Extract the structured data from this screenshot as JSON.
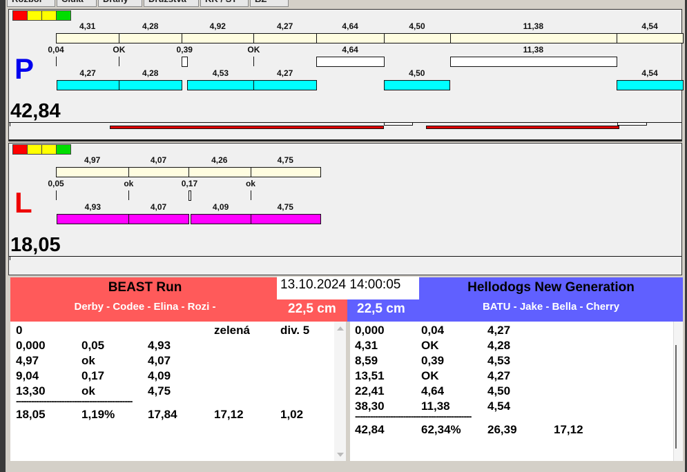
{
  "tabs": [
    "Rozbor",
    "Čidla",
    "Dráhy",
    "Družstva",
    "KK / ST",
    "BZ"
  ],
  "colors": {
    "lights": [
      "#ff0000",
      "#ffff00",
      "#ffff00",
      "#00dd00"
    ],
    "split": "#fffde0",
    "run_p": "#00ffff",
    "run_l": "#ff00ff",
    "red_team": "#ff5a5a",
    "blue_team": "#6060ff",
    "fault_bar": "#dd0000"
  },
  "lanes": [
    {
      "id": "P",
      "letter": "P",
      "letter_color": "#0000ee",
      "total": "42,84",
      "splits": [
        "4,31",
        "4,28",
        "4,92",
        "4,27",
        "4,64",
        "4,50",
        "11,38",
        "4,54"
      ],
      "exchanges": [
        {
          "label": "0,04",
          "start_s": 0,
          "dur_s": 0.04
        },
        {
          "label": "OK",
          "start_s": 4.31,
          "dur_s": 0
        },
        {
          "label": "0,39",
          "start_s": 8.59,
          "dur_s": 0.39
        },
        {
          "label": "OK",
          "start_s": 13.51,
          "dur_s": 0
        },
        {
          "label": "4,64",
          "start_s": 17.78,
          "dur_s": 4.64
        },
        {
          "label": "11,38",
          "start_s": 26.92,
          "dur_s": 11.38
        }
      ],
      "runs": [
        {
          "label": "4,27",
          "start_s": 0.04,
          "dur_s": 4.27
        },
        {
          "label": "4,28",
          "start_s": 4.31,
          "dur_s": 4.28
        },
        {
          "label": "4,53",
          "start_s": 8.98,
          "dur_s": 4.53
        },
        {
          "label": "4,27",
          "start_s": 13.51,
          "dur_s": 4.27
        },
        {
          "label": "4,50",
          "start_s": 22.41,
          "dur_s": 4.5
        },
        {
          "label": "4,54",
          "start_s": 38.3,
          "dur_s": 4.54
        }
      ],
      "timeline_red": [
        [
          3.7,
          22.41
        ],
        [
          25.3,
          38.5
        ]
      ],
      "timeline_white": [
        [
          22.41,
          24.4
        ],
        [
          38.35,
          40.4
        ]
      ]
    },
    {
      "id": "L",
      "letter": "L",
      "letter_color": "#ee0000",
      "total": "18,05",
      "splits": [
        "4,97",
        "4,07",
        "4,26",
        "4,75"
      ],
      "exchanges": [
        {
          "label": "0,05",
          "start_s": 0,
          "dur_s": 0.05
        },
        {
          "label": "ok",
          "start_s": 4.97,
          "dur_s": 0
        },
        {
          "label": "0,17",
          "start_s": 9.04,
          "dur_s": 0.17
        },
        {
          "label": "ok",
          "start_s": 13.3,
          "dur_s": 0
        }
      ],
      "runs": [
        {
          "label": "4,93",
          "start_s": 0.05,
          "dur_s": 4.93
        },
        {
          "label": "4,07",
          "start_s": 4.97,
          "dur_s": 4.07
        },
        {
          "label": "4,09",
          "start_s": 9.21,
          "dur_s": 4.09
        },
        {
          "label": "4,75",
          "start_s": 13.3,
          "dur_s": 4.75
        }
      ],
      "timeline_red": [],
      "timeline_white": []
    }
  ],
  "datetime": "13.10.2024 14:00:05",
  "left_team": {
    "name": "BEAST Run",
    "members": "Derby - Codee - Elina - Rozi -",
    "height": "22,5 cm",
    "rows": [
      [
        "0",
        "",
        "",
        "zelená",
        "div. 5"
      ],
      [
        "0,000",
        "0,05",
        "4,93",
        "",
        ""
      ],
      [
        "4,97",
        "ok",
        "4,07",
        "",
        ""
      ],
      [
        "9,04",
        "0,17",
        "4,09",
        "",
        ""
      ],
      [
        "13,30",
        "ok",
        "4,75",
        "",
        ""
      ]
    ],
    "separator": "----------------------------------------------",
    "summary": [
      "18,05",
      "1,19%",
      "17,84",
      "17,12",
      "1,02"
    ]
  },
  "right_team": {
    "name": "Hellodogs New Generation",
    "members": "BATU - Jake - Bella - Cherry",
    "height": "22,5 cm",
    "rows": [
      [
        "0,000",
        "0,04",
        "4,27"
      ],
      [
        "4,31",
        "OK",
        "4,28"
      ],
      [
        "8,59",
        "0,39",
        "4,53"
      ],
      [
        "13,51",
        "OK",
        "4,27"
      ],
      [
        "22,41",
        "4,64",
        "4,50"
      ],
      [
        "38,30",
        "11,38",
        "4,54"
      ]
    ],
    "separator": "----------------------------------------------",
    "summary": [
      "42,84",
      "62,34%",
      "26,39",
      "17,12"
    ]
  }
}
